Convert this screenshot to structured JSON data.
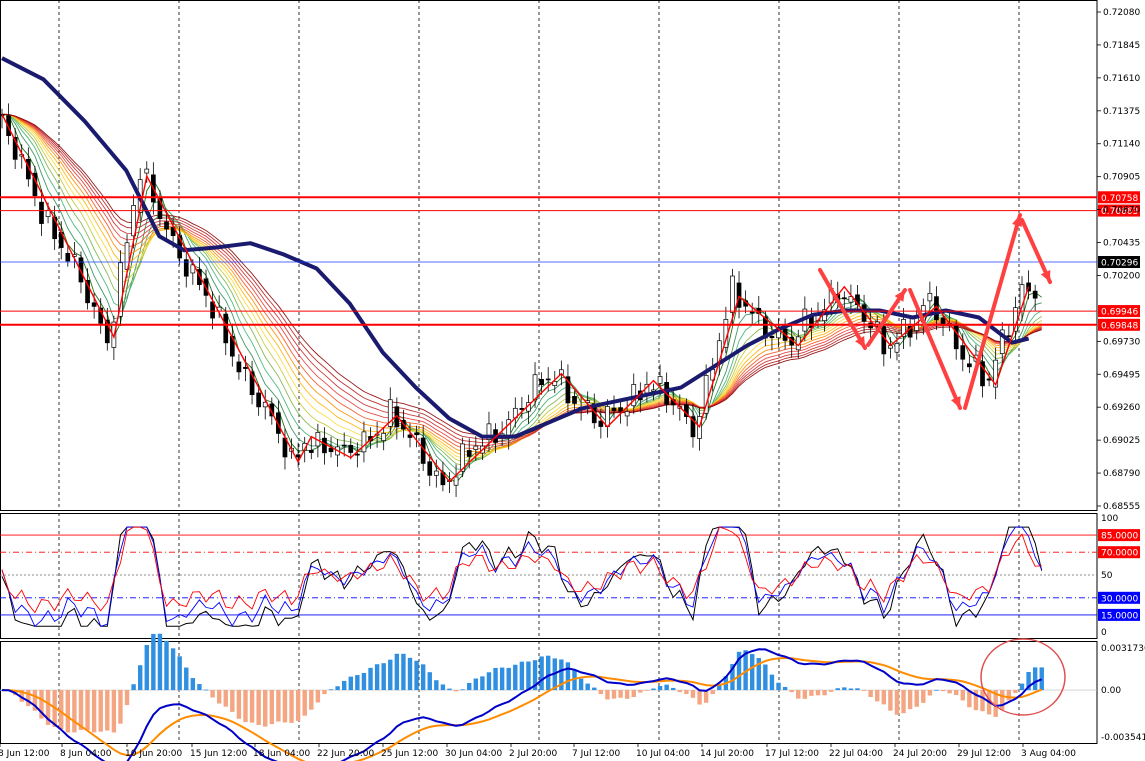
{
  "chart_data": {
    "type": "candlestick",
    "main": {
      "ylim": [
        0.68555,
        0.7208
      ],
      "y_ticks": [
        "0.72080",
        "0.71845",
        "0.71610",
        "0.71375",
        "0.71140",
        "0.70905",
        "0.70670",
        "0.70435",
        "0.70200",
        "0.69730",
        "0.69495",
        "0.69260",
        "0.69025",
        "0.68790",
        "0.68555"
      ],
      "x_ticks": [
        "8 Jun 12:00",
        "8 Jun 04:00",
        "10 Jun 20:00",
        "15 Jun 12:00",
        "18 Jun 04:00",
        "22 Jun 20:00",
        "25 Jun 12:00",
        "30 Jun 04:00",
        "2 Jul 20:00",
        "7 Jul 12:00",
        "10 Jul 04:00",
        "14 Jul 20:00",
        "17 Jul 12:00",
        "22 Jul 04:00",
        "24 Jul 20:00",
        "29 Jul 12:00",
        "3 Aug 04:00"
      ],
      "levels": [
        {
          "label": "0.70758",
          "value": 0.70758,
          "color": "#ff0000",
          "style": "solid-thick"
        },
        {
          "label": "0.70663",
          "value": 0.70663,
          "color": "#ff0000",
          "style": "solid"
        },
        {
          "label": "0.70296",
          "value": 0.70296,
          "color": "#1e3cff",
          "style": "current"
        },
        {
          "label": "0.69946",
          "value": 0.69946,
          "color": "#ff0000",
          "style": "solid"
        },
        {
          "label": "0.69848",
          "value": 0.69848,
          "color": "#ff0000",
          "style": "solid-thick"
        }
      ],
      "zigzag": [
        [
          0,
          0.7135
        ],
        [
          17,
          0.6976
        ],
        [
          22,
          0.7091
        ],
        [
          45,
          0.6887
        ],
        [
          47,
          0.6905
        ],
        [
          53,
          0.689
        ],
        [
          60,
          0.692
        ],
        [
          68,
          0.6873
        ],
        [
          85,
          0.695
        ],
        [
          92,
          0.6912
        ],
        [
          99,
          0.6945
        ],
        [
          106,
          0.6912
        ],
        [
          112,
          0.7005
        ],
        [
          121,
          0.697
        ],
        [
          128,
          0.7012
        ],
        [
          135,
          0.697
        ],
        [
          142,
          0.6998
        ],
        [
          151,
          0.6942
        ],
        [
          156,
          0.7012
        ]
      ],
      "ma_slow": [
        [
          0,
          0.7175
        ],
        [
          5,
          0.716
        ],
        [
          10,
          0.713
        ],
        [
          15,
          0.7095
        ],
        [
          19,
          0.7048
        ],
        [
          22,
          0.7038
        ],
        [
          26,
          0.704
        ],
        [
          30,
          0.7043
        ],
        [
          34,
          0.7035
        ],
        [
          38,
          0.7025
        ],
        [
          42,
          0.7
        ],
        [
          46,
          0.6965
        ],
        [
          50,
          0.694
        ],
        [
          54,
          0.6918
        ],
        [
          58,
          0.6905
        ],
        [
          62,
          0.6905
        ],
        [
          66,
          0.6915
        ],
        [
          70,
          0.6925
        ],
        [
          74,
          0.693
        ],
        [
          78,
          0.6935
        ],
        [
          82,
          0.694
        ],
        [
          86,
          0.6955
        ],
        [
          90,
          0.697
        ],
        [
          94,
          0.6982
        ],
        [
          98,
          0.6992
        ],
        [
          102,
          0.6995
        ],
        [
          106,
          0.6995
        ],
        [
          110,
          0.699
        ],
        [
          114,
          0.6995
        ],
        [
          118,
          0.699
        ],
        [
          122,
          0.6972
        ],
        [
          124,
          0.6975
        ]
      ],
      "ma_fast": [
        [
          0,
          0.7165
        ],
        [
          5,
          0.714
        ],
        [
          10,
          0.7095
        ],
        [
          15,
          0.704
        ],
        [
          18,
          0.7
        ],
        [
          20,
          0.701
        ],
        [
          23,
          0.704
        ],
        [
          26,
          0.706
        ],
        [
          29,
          0.706
        ],
        [
          32,
          0.704
        ],
        [
          36,
          0.701
        ],
        [
          40,
          0.698
        ],
        [
          44,
          0.694
        ],
        [
          48,
          0.6915
        ],
        [
          52,
          0.6905
        ],
        [
          56,
          0.691
        ],
        [
          60,
          0.692
        ],
        [
          64,
          0.6925
        ],
        [
          68,
          0.693
        ],
        [
          72,
          0.694
        ],
        [
          76,
          0.696
        ],
        [
          80,
          0.6985
        ],
        [
          84,
          0.6995
        ],
        [
          88,
          0.7
        ],
        [
          92,
          0.699
        ],
        [
          96,
          0.6985
        ],
        [
          100,
          0.698
        ],
        [
          104,
          0.6985
        ],
        [
          108,
          0.699
        ],
        [
          112,
          0.6985
        ],
        [
          116,
          0.6975
        ],
        [
          120,
          0.698
        ],
        [
          124,
          0.6985
        ]
      ],
      "bars": 160
    },
    "rsi": {
      "ylim": [
        0,
        100
      ],
      "y_ticks": [
        "100",
        "50",
        "0"
      ],
      "levels": [
        {
          "label": "85.0000",
          "value": 85,
          "color": "#ff0000",
          "style": "solid"
        },
        {
          "label": "70.0000",
          "value": 70,
          "color": "#ff0000",
          "style": "dashdot"
        },
        {
          "label": "30.0000",
          "value": 30,
          "color": "#0000ff",
          "style": "dashdot"
        },
        {
          "label": "15.0000",
          "value": 15,
          "color": "#0000ff",
          "style": "solid"
        }
      ]
    },
    "macd": {
      "ylim": [
        -0.003541,
        0.003173
      ],
      "y_ticks": [
        {
          "label": "0.0031736",
          "value": 0.003173
        },
        {
          "label": "0.00",
          "value": 0
        },
        {
          "label": "-0.003541",
          "value": -0.003541
        }
      ]
    }
  },
  "icons": {
    "arrows": "trend-arrow-icon",
    "highlight": "highlight-circle-icon"
  },
  "colors": {
    "up_line": "#000000",
    "grid": "#000000",
    "zigzag": "#ff0000",
    "ma": "#1a1a6e",
    "macd_pos": "#2f8fe0",
    "macd_neg": "#f4a582",
    "macd_line": "#0000c8",
    "signal_line": "#ff8c00"
  }
}
